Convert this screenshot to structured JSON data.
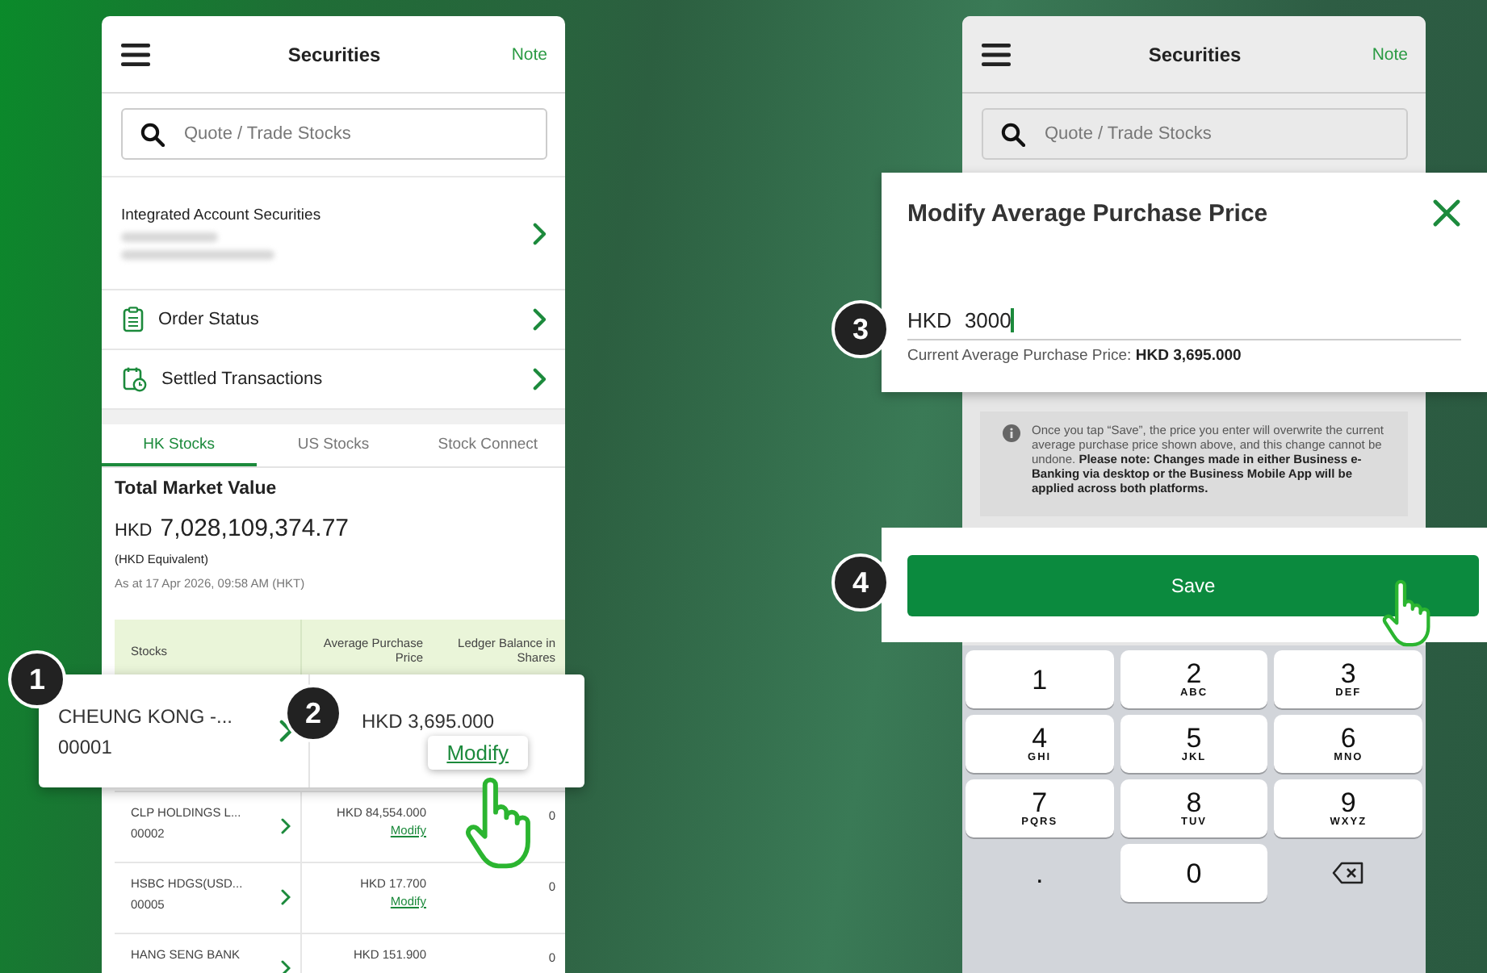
{
  "left_screen": {
    "header": {
      "title": "Securities",
      "action": "Note"
    },
    "search": {
      "placeholder": "Quote / Trade Stocks"
    },
    "account": {
      "title": "Integrated Account Securities"
    },
    "menu": [
      {
        "kind": "orders",
        "label": "Order Status"
      },
      {
        "kind": "settled",
        "label": "Settled Transactions"
      }
    ],
    "tabs": [
      {
        "label": "HK Stocks",
        "selected": true
      },
      {
        "label": "US Stocks",
        "selected": false
      },
      {
        "label": "Stock Connect",
        "selected": false
      }
    ],
    "summary": {
      "title": "Total Market Value",
      "currency": "HKD",
      "amount": "7,028,109,374.77",
      "note": "(HKD Equivalent)",
      "as_at": "As at 17 Apr 2026, 09:58 AM (HKT)"
    },
    "table": {
      "columns": [
        "Stocks",
        "Average Purchase Price",
        "Ledger Balance in Shares"
      ],
      "rows": [
        {
          "name": "CLP HOLDINGS L...",
          "code": "00002",
          "price": "HKD 84,554.000",
          "action": "Modify",
          "shares": "0"
        },
        {
          "name": "HSBC HDGS(USD...",
          "code": "00005",
          "price": "HKD 17.700",
          "action": "Modify",
          "shares": "0"
        },
        {
          "name": "HANG SENG BANK",
          "price": "HKD 151.900",
          "shares": "0"
        }
      ]
    }
  },
  "highlighted_row": {
    "step": "1",
    "name": "CHEUNG KONG -...",
    "code": "00001",
    "step_price": "2",
    "price": "HKD 3,695.000",
    "action": "Modify"
  },
  "right_screen": {
    "header": {
      "title": "Securities",
      "action": "Note"
    },
    "search": {
      "placeholder": "Quote / Trade Stocks"
    },
    "notice": "Once you tap “Save”, the price you enter will overwrite the current average purchase price shown above, and this change cannot be undone. **Please note: Changes made in either Business e-Banking via desktop or the Business Mobile App will be applied across both platforms.**",
    "keypad": [
      {
        "kind": "digit",
        "digit": "1"
      },
      {
        "kind": "digit",
        "digit": "2",
        "letters": "ABC"
      },
      {
        "kind": "digit",
        "digit": "3",
        "letters": "DEF"
      },
      {
        "kind": "digit",
        "digit": "4",
        "letters": "GHI"
      },
      {
        "kind": "digit",
        "digit": "5",
        "letters": "JKL"
      },
      {
        "kind": "digit",
        "digit": "6",
        "letters": "MNO"
      },
      {
        "kind": "digit",
        "digit": "7",
        "letters": "PQRS"
      },
      {
        "kind": "digit",
        "digit": "8",
        "letters": "TUV"
      },
      {
        "kind": "digit",
        "digit": "9",
        "letters": "WXYZ"
      },
      {
        "kind": "plain",
        "digit": "."
      },
      {
        "kind": "digit",
        "digit": "0"
      },
      {
        "kind": "backspace"
      }
    ]
  },
  "modal": {
    "step": "3",
    "title": "Modify Average Purchase Price",
    "currency": "HKD",
    "value": "3000",
    "current": "Current Average Purchase Price: **HKD 3,695.000**"
  },
  "save": {
    "step": "4",
    "label": "Save"
  }
}
